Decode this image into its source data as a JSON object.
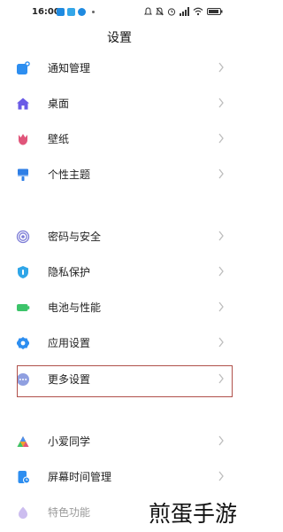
{
  "status_bar": {
    "time": "16:00",
    "left_icon_colors": [
      "#1f8ae0",
      "#34a6e8",
      "#1f8ae0"
    ],
    "right_icons": [
      "notification-icon",
      "alarm-icon",
      "signal-icon",
      "wifi-icon",
      "battery-icon"
    ]
  },
  "page": {
    "title": "设置"
  },
  "settings": {
    "items": [
      {
        "label": "通知管理",
        "icon": "notification-manager-icon",
        "color": "#2d8ef0"
      },
      {
        "label": "桌面",
        "icon": "home-icon",
        "color": "#6a5be6"
      },
      {
        "label": "壁纸",
        "icon": "tulip-icon",
        "color": "#e0557a"
      },
      {
        "label": "个性主题",
        "icon": "brush-icon",
        "color": "#2f7fe6"
      },
      {
        "label": "密码与安全",
        "icon": "fingerprint-icon",
        "color": "#7b7bd6"
      },
      {
        "label": "隐私保护",
        "icon": "privacy-shield-icon",
        "color": "#2fa6e8"
      },
      {
        "label": "电池与性能",
        "icon": "battery-icon",
        "color": "#3cc46a"
      },
      {
        "label": "应用设置",
        "icon": "gear-icon",
        "color": "#2d8ef0"
      },
      {
        "label": "更多设置",
        "icon": "more-dots-icon",
        "color": "#8f9fe0"
      },
      {
        "label": "小爱同学",
        "icon": "xiaoai-icon",
        "color": "#f0a030"
      },
      {
        "label": "屏幕时间管理",
        "icon": "screen-time-icon",
        "color": "#2d8ef0"
      },
      {
        "label": "特色功能",
        "icon": "special-features-icon",
        "color": "#9a7de0"
      }
    ]
  },
  "highlight_color": "#b0504a",
  "watermark": "煎蛋手游"
}
